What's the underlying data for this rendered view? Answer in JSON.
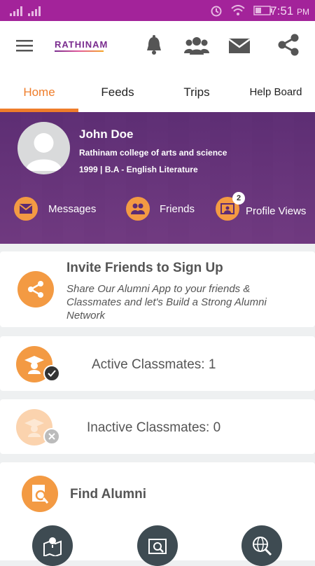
{
  "status_bar": {
    "time": "7:51",
    "ampm": "PM"
  },
  "app_bar": {
    "logo_text": "RATHINAM"
  },
  "tabs": [
    {
      "label": "Home"
    },
    {
      "label": "Feeds"
    },
    {
      "label": "Trips"
    },
    {
      "label": "Help Board"
    }
  ],
  "profile": {
    "name": "John Doe",
    "college": "Rathinam college of arts and science",
    "batch": "1999 | B.A - English Literature"
  },
  "hero_actions": {
    "messages": "Messages",
    "friends": "Friends",
    "profile_views": "Profile Views",
    "profile_views_count": "2"
  },
  "invite": {
    "title": "Invite Friends to Sign Up",
    "description": "Share Our Alumni App to your friends & Classmates and let's Build a Strong Alumni Network"
  },
  "classmates": {
    "active": "Active Classmates: 1",
    "inactive": "Inactive Classmates: 0"
  },
  "find_alumni": {
    "title": "Find Alumni"
  },
  "colors": {
    "status_bar": "#a3239a",
    "accent": "#ef7d2a",
    "orange_circle": "#f39a43",
    "dark_circle": "#3e4b52"
  }
}
